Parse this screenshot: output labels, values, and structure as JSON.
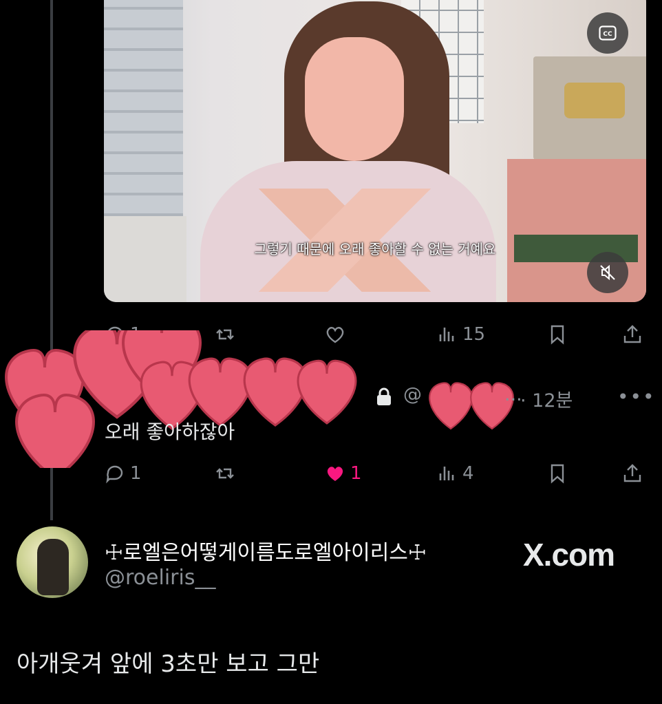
{
  "video": {
    "subtitle": "그렇기 때문에 오래 좋아할 수 없는 거예요",
    "cc_icon": "closed-captions-icon",
    "mute_icon": "muted-speaker-icon"
  },
  "video_actions": {
    "replies": "1",
    "retweets": "",
    "likes": "",
    "views": "15"
  },
  "reply": {
    "lock_icon": "lock-icon",
    "handle_prefix": "@",
    "handle_suffix": "...",
    "time": "· 12분",
    "more": "•••",
    "text": "오래 좋아하잖아",
    "actions": {
      "replies": "1",
      "retweets": "",
      "likes": "1",
      "views": "4"
    },
    "like_color": "#f91880"
  },
  "author": {
    "name": "☩로엘은어떻게이름도로엘아이리스☩",
    "handle": "@roeliris__",
    "brand": "X.com"
  },
  "post": {
    "text": "아개웃겨 앞에 3초만 보고 그만"
  }
}
